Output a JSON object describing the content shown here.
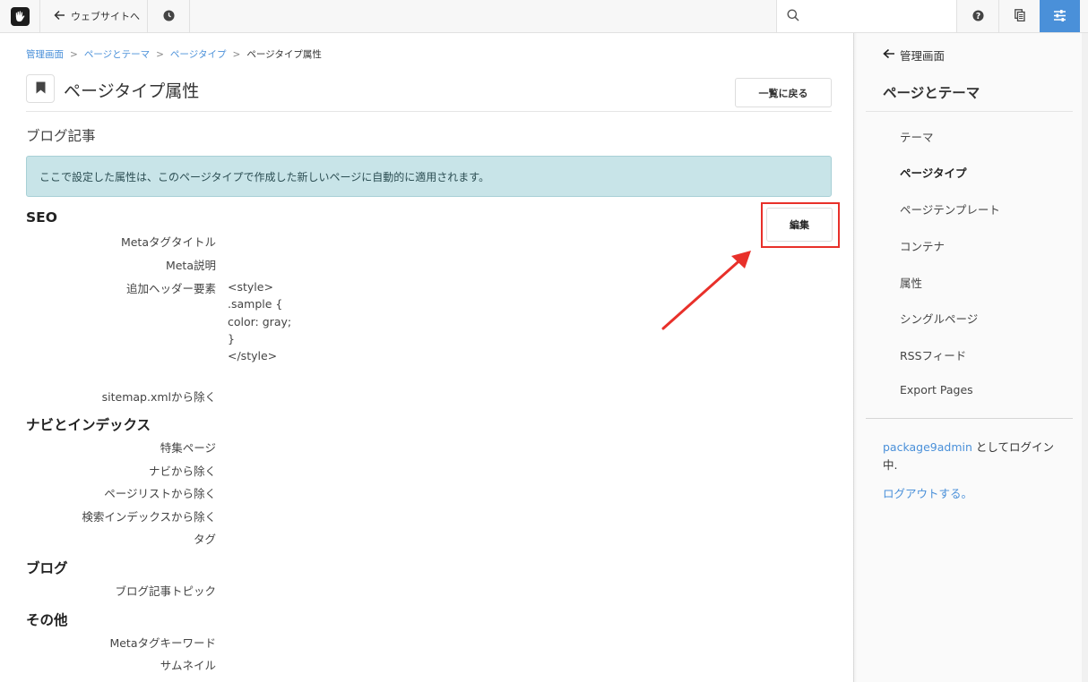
{
  "toolbar": {
    "back_label": "ウェブサイトへ",
    "search_placeholder": "",
    "accent_color": "#4a90d9"
  },
  "breadcrumb": {
    "items": [
      "管理画面",
      "ページとテーマ",
      "ページタイプ"
    ],
    "current": "ページタイプ属性"
  },
  "header": {
    "title": "ページタイプ属性",
    "back_list_label": "一覧に戻る"
  },
  "subtitle": "ブログ記事",
  "info_message": "ここで設定した属性は、このページタイプで作成した新しいページに自動的に適用されます。",
  "edit_label": "編集",
  "sections": {
    "seo": {
      "title": "SEO",
      "labels": [
        "Metaタグタイトル",
        "Meta説明",
        "追加ヘッダー要素",
        "sitemap.xmlから除く"
      ],
      "header_value": "<style>\n.sample {\ncolor: gray;\n}\n</style>"
    },
    "navi": {
      "title": "ナビとインデックス",
      "labels": [
        "特集ページ",
        "ナビから除く",
        "ページリストから除く",
        "検索インデックスから除く",
        "タグ"
      ]
    },
    "blog": {
      "title": "ブログ",
      "labels": [
        "ブログ記事トピック"
      ]
    },
    "other": {
      "title": "その他",
      "labels": [
        "Metaタグキーワード",
        "サムネイル"
      ]
    }
  },
  "panel": {
    "back_label": "管理画面",
    "heading": "ページとテーマ",
    "items": [
      "テーマ",
      "ページタイプ",
      "ページテンプレート",
      "コンテナ",
      "属性",
      "シングルページ",
      "RSSフィード",
      "Export Pages"
    ],
    "active_index": 1,
    "login_user": "package9admin",
    "login_suffix": " としてログイン中.",
    "logout_label": "ログアウトする。"
  },
  "annotation_color": "#e8302a"
}
